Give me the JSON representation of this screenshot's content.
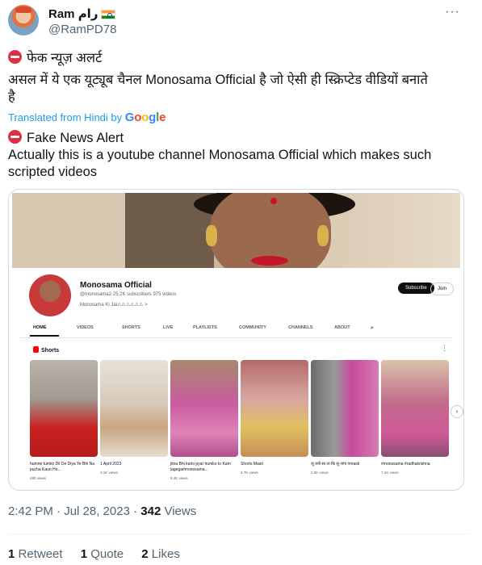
{
  "author": {
    "name": "Ram رام",
    "handle": "@RamPD78"
  },
  "tweet": {
    "hindi_line1": "फेक न्यूज़ अलर्ट",
    "hindi_line2": "असल में ये एक यूट्यूब चैनल Monosama Official है जो ऐसी ही स्क्रिप्टेड वीडियों बनाते",
    "hindi_line3": "है",
    "translated_label": "Translated from Hindi by",
    "translated_g": [
      "G",
      "o",
      "o",
      "g",
      "l",
      "e"
    ],
    "en_line1": "Fake News Alert",
    "en_line2": "Actually this is a youtube channel Monosama Official which makes such",
    "en_line3": "scripted videos"
  },
  "youtube": {
    "channel_name": "Monosama Official",
    "channel_meta": "@monosama2  25.2K subscribers  975 videos",
    "channel_link": "Monosama Ki Jai⚠⚠⚠⚠⚠⚠   >",
    "subscribe": "Subscribe",
    "join": "Join",
    "tabs": [
      "HOME",
      "VIDEOS",
      "SHORTS",
      "LIVE",
      "PLAYLISTS",
      "COMMUNITY",
      "CHANNELS",
      "ABOUT"
    ],
    "shorts_heading": "Shorts",
    "shorts": [
      {
        "title": "humne tumko Dil De Diya Ye Bhi Na pucha Kaun Ho...",
        "views": "480 views"
      },
      {
        "title": "1 April 2023",
        "views": "3.1K views"
      },
      {
        "title": "jitna Bhi karlo pyar humko to Kam lagega#monosama...",
        "views": "8.4K views"
      },
      {
        "title": "Shorts Masti",
        "views": "3.7K views"
      },
      {
        "title": "जू तनी सा ता कि सू जगा #masti",
        "views": "2.6K views"
      },
      {
        "title": "#monosama #radhakrishna",
        "views": "7.1K views"
      }
    ]
  },
  "footer": {
    "time": "2:42 PM · Jul 28, 2023 ·",
    "views_count": "342",
    "views_label": "Views",
    "retweets_count": "1",
    "retweets_label": "Retweet",
    "quotes_count": "1",
    "quotes_label": "Quote",
    "likes_count": "2",
    "likes_label": "Likes"
  }
}
